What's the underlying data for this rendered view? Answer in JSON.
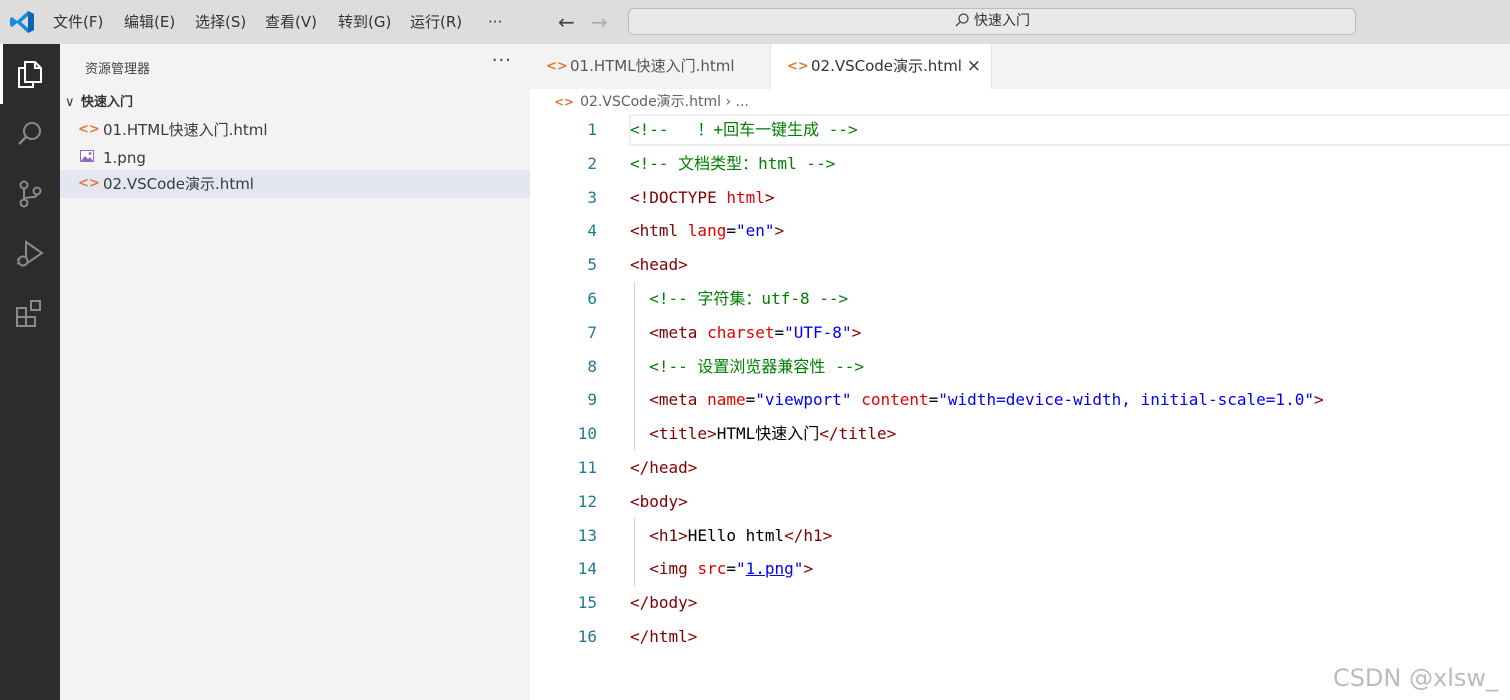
{
  "menu": {
    "items": [
      "文件(F)",
      "编辑(E)",
      "选择(S)",
      "查看(V)",
      "转到(G)",
      "运行(R)",
      "···"
    ]
  },
  "search": {
    "label": "快速入门"
  },
  "sidebar": {
    "title": "资源管理器",
    "more": "···",
    "folder": {
      "chevron": "∨",
      "name": "快速入门"
    },
    "files": [
      {
        "name": "01.HTML快速入门.html",
        "icon": "html-file-icon"
      },
      {
        "name": "1.png",
        "icon": "image-file-icon"
      },
      {
        "name": "02.VSCode演示.html",
        "icon": "html-file-icon",
        "selected": true
      }
    ]
  },
  "tabs": [
    {
      "label": "01.HTML快速入门.html",
      "active": false
    },
    {
      "label": "02.VSCode演示.html",
      "active": true,
      "close": "×"
    }
  ],
  "breadcrumb": {
    "file": "02.VSCode演示.html",
    "sep": " › ",
    "tail": "..."
  },
  "editor": {
    "lines": [
      {
        "n": "1",
        "indent": "",
        "tokens": [
          {
            "t": "c",
            "v": "<!--   ！+回车一键生成 -->"
          }
        ]
      },
      {
        "n": "2",
        "indent": "",
        "tokens": [
          {
            "t": "c",
            "v": "<!-- 文档类型：html -->"
          }
        ]
      },
      {
        "n": "3",
        "indent": "",
        "tokens": [
          {
            "t": "g",
            "v": "<!DOCTYPE "
          },
          {
            "t": "a",
            "v": "html"
          },
          {
            "t": "g",
            "v": ">"
          }
        ]
      },
      {
        "n": "4",
        "indent": "",
        "tokens": [
          {
            "t": "g",
            "v": "<html "
          },
          {
            "t": "a",
            "v": "lang"
          },
          {
            "t": "x",
            "v": "="
          },
          {
            "t": "v",
            "v": "\"en\""
          },
          {
            "t": "g",
            "v": ">"
          }
        ]
      },
      {
        "n": "5",
        "indent": "",
        "tokens": [
          {
            "t": "g",
            "v": "<head>"
          }
        ]
      },
      {
        "n": "6",
        "indent": "  ",
        "tokens": [
          {
            "t": "c",
            "v": "<!-- 字符集：utf-8 -->"
          }
        ]
      },
      {
        "n": "7",
        "indent": "  ",
        "tokens": [
          {
            "t": "g",
            "v": "<meta "
          },
          {
            "t": "a",
            "v": "charset"
          },
          {
            "t": "x",
            "v": "="
          },
          {
            "t": "v",
            "v": "\"UTF-8\""
          },
          {
            "t": "g",
            "v": ">"
          }
        ]
      },
      {
        "n": "8",
        "indent": "  ",
        "tokens": [
          {
            "t": "c",
            "v": "<!-- 设置浏览器兼容性 -->"
          }
        ]
      },
      {
        "n": "9",
        "indent": "  ",
        "tokens": [
          {
            "t": "g",
            "v": "<meta "
          },
          {
            "t": "a",
            "v": "name"
          },
          {
            "t": "x",
            "v": "="
          },
          {
            "t": "v",
            "v": "\"viewport\""
          },
          {
            "t": "x",
            "v": " "
          },
          {
            "t": "a",
            "v": "content"
          },
          {
            "t": "x",
            "v": "="
          },
          {
            "t": "v",
            "v": "\"width=device-width, initial-scale=1.0\""
          },
          {
            "t": "g",
            "v": ">"
          }
        ]
      },
      {
        "n": "10",
        "indent": "  ",
        "tokens": [
          {
            "t": "g",
            "v": "<title>"
          },
          {
            "t": "x",
            "v": "HTML快速入门"
          },
          {
            "t": "g",
            "v": "</title>"
          }
        ]
      },
      {
        "n": "11",
        "indent": "",
        "tokens": [
          {
            "t": "g",
            "v": "</head>"
          }
        ]
      },
      {
        "n": "12",
        "indent": "",
        "tokens": [
          {
            "t": "g",
            "v": "<body>"
          }
        ]
      },
      {
        "n": "13",
        "indent": "  ",
        "tokens": [
          {
            "t": "g",
            "v": "<h1>"
          },
          {
            "t": "x",
            "v": "HEllo html"
          },
          {
            "t": "g",
            "v": "</h1>"
          }
        ]
      },
      {
        "n": "14",
        "indent": "  ",
        "tokens": [
          {
            "t": "g",
            "v": "<img "
          },
          {
            "t": "a",
            "v": "src"
          },
          {
            "t": "x",
            "v": "="
          },
          {
            "t": "v",
            "v": "\""
          },
          {
            "t": "l",
            "v": "1.png"
          },
          {
            "t": "v",
            "v": "\""
          },
          {
            "t": "g",
            "v": ">"
          }
        ]
      },
      {
        "n": "15",
        "indent": "",
        "tokens": [
          {
            "t": "g",
            "v": "</body>"
          }
        ]
      },
      {
        "n": "16",
        "indent": "",
        "tokens": [
          {
            "t": "g",
            "v": "</html>"
          }
        ]
      }
    ]
  },
  "watermark": "CSDN @xlsw_"
}
